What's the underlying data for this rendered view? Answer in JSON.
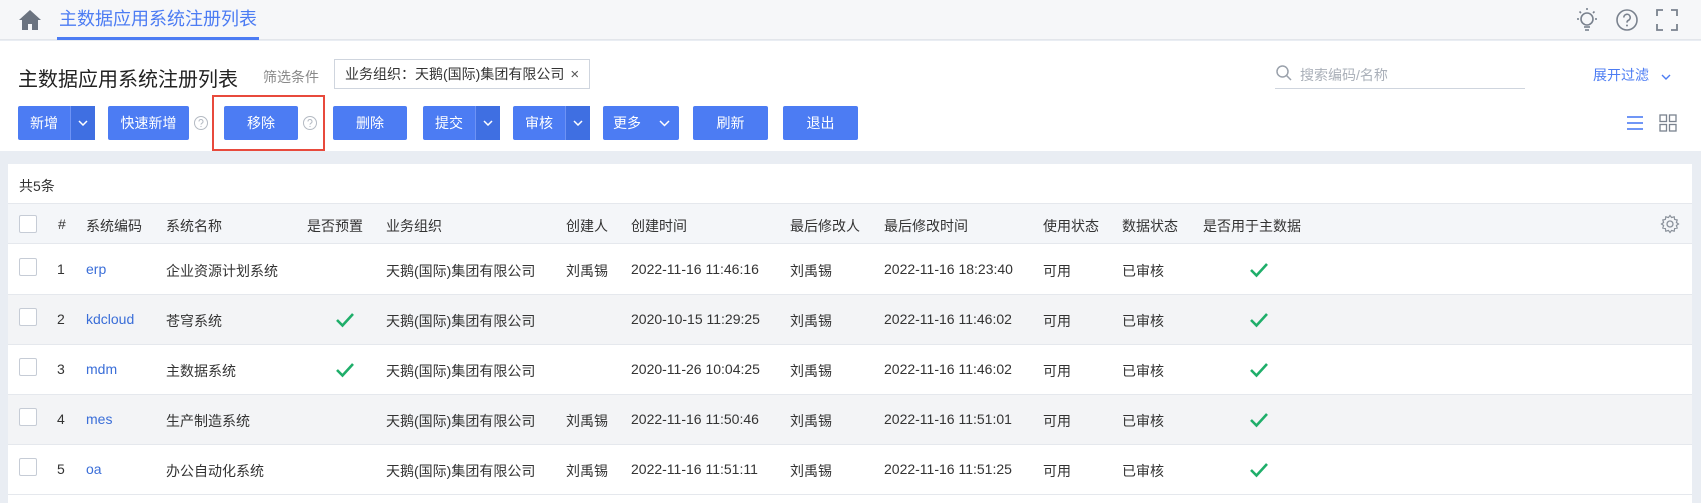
{
  "topbar": {
    "tab_label": "主数据应用系统注册列表"
  },
  "toolbar": {
    "page_title": "主数据应用系统注册列表",
    "filter_label": "筛选条件",
    "filter_chip": "业务组织：天鹅(国际)集团有限公司",
    "filter_chip_close": "×",
    "search_placeholder": "搜索编码/名称",
    "expand_filter": "展开过滤",
    "buttons": {
      "add": "新增",
      "quick_add": "快速新增",
      "remove": "移除",
      "delete": "删除",
      "submit": "提交",
      "audit": "审核",
      "more": "更多",
      "refresh": "刷新",
      "exit": "退出"
    }
  },
  "table": {
    "count": "共5条",
    "headers": [
      "#",
      "系统编码",
      "系统名称",
      "是否预置",
      "业务组织",
      "创建人",
      "创建时间",
      "最后修改人",
      "最后修改时间",
      "使用状态",
      "数据状态",
      "是否用于主数据"
    ],
    "rows": [
      {
        "no": "1",
        "code": "erp",
        "name": "企业资源计划系统",
        "preset": false,
        "org": "天鹅(国际)集团有限公司",
        "creator": "刘禹锡",
        "created": "2022-11-16 11:46:16",
        "modifier": "刘禹锡",
        "modified": "2022-11-16 18:23:40",
        "use_status": "可用",
        "data_status": "已审核",
        "for_master": true
      },
      {
        "no": "2",
        "code": "kdcloud",
        "name": "苍穹系统",
        "preset": true,
        "org": "天鹅(国际)集团有限公司",
        "creator": "",
        "created": "2020-10-15 11:29:25",
        "modifier": "刘禹锡",
        "modified": "2022-11-16 11:46:02",
        "use_status": "可用",
        "data_status": "已审核",
        "for_master": true
      },
      {
        "no": "3",
        "code": "mdm",
        "name": "主数据系统",
        "preset": true,
        "org": "天鹅(国际)集团有限公司",
        "creator": "",
        "created": "2020-11-26 10:04:25",
        "modifier": "刘禹锡",
        "modified": "2022-11-16 11:46:02",
        "use_status": "可用",
        "data_status": "已审核",
        "for_master": true
      },
      {
        "no": "4",
        "code": "mes",
        "name": "生产制造系统",
        "preset": false,
        "org": "天鹅(国际)集团有限公司",
        "creator": "刘禹锡",
        "created": "2022-11-16 11:50:46",
        "modifier": "刘禹锡",
        "modified": "2022-11-16 11:51:01",
        "use_status": "可用",
        "data_status": "已审核",
        "for_master": true
      },
      {
        "no": "5",
        "code": "oa",
        "name": "办公自动化系统",
        "preset": false,
        "org": "天鹅(国际)集团有限公司",
        "creator": "刘禹锡",
        "created": "2022-11-16 11:51:11",
        "modifier": "刘禹锡",
        "modified": "2022-11-16 11:51:25",
        "use_status": "可用",
        "data_status": "已审核",
        "for_master": true
      }
    ]
  },
  "colors": {
    "primary": "#4c7cf3",
    "check_green": "#1fae6a",
    "highlight_border": "#e84a3c"
  }
}
